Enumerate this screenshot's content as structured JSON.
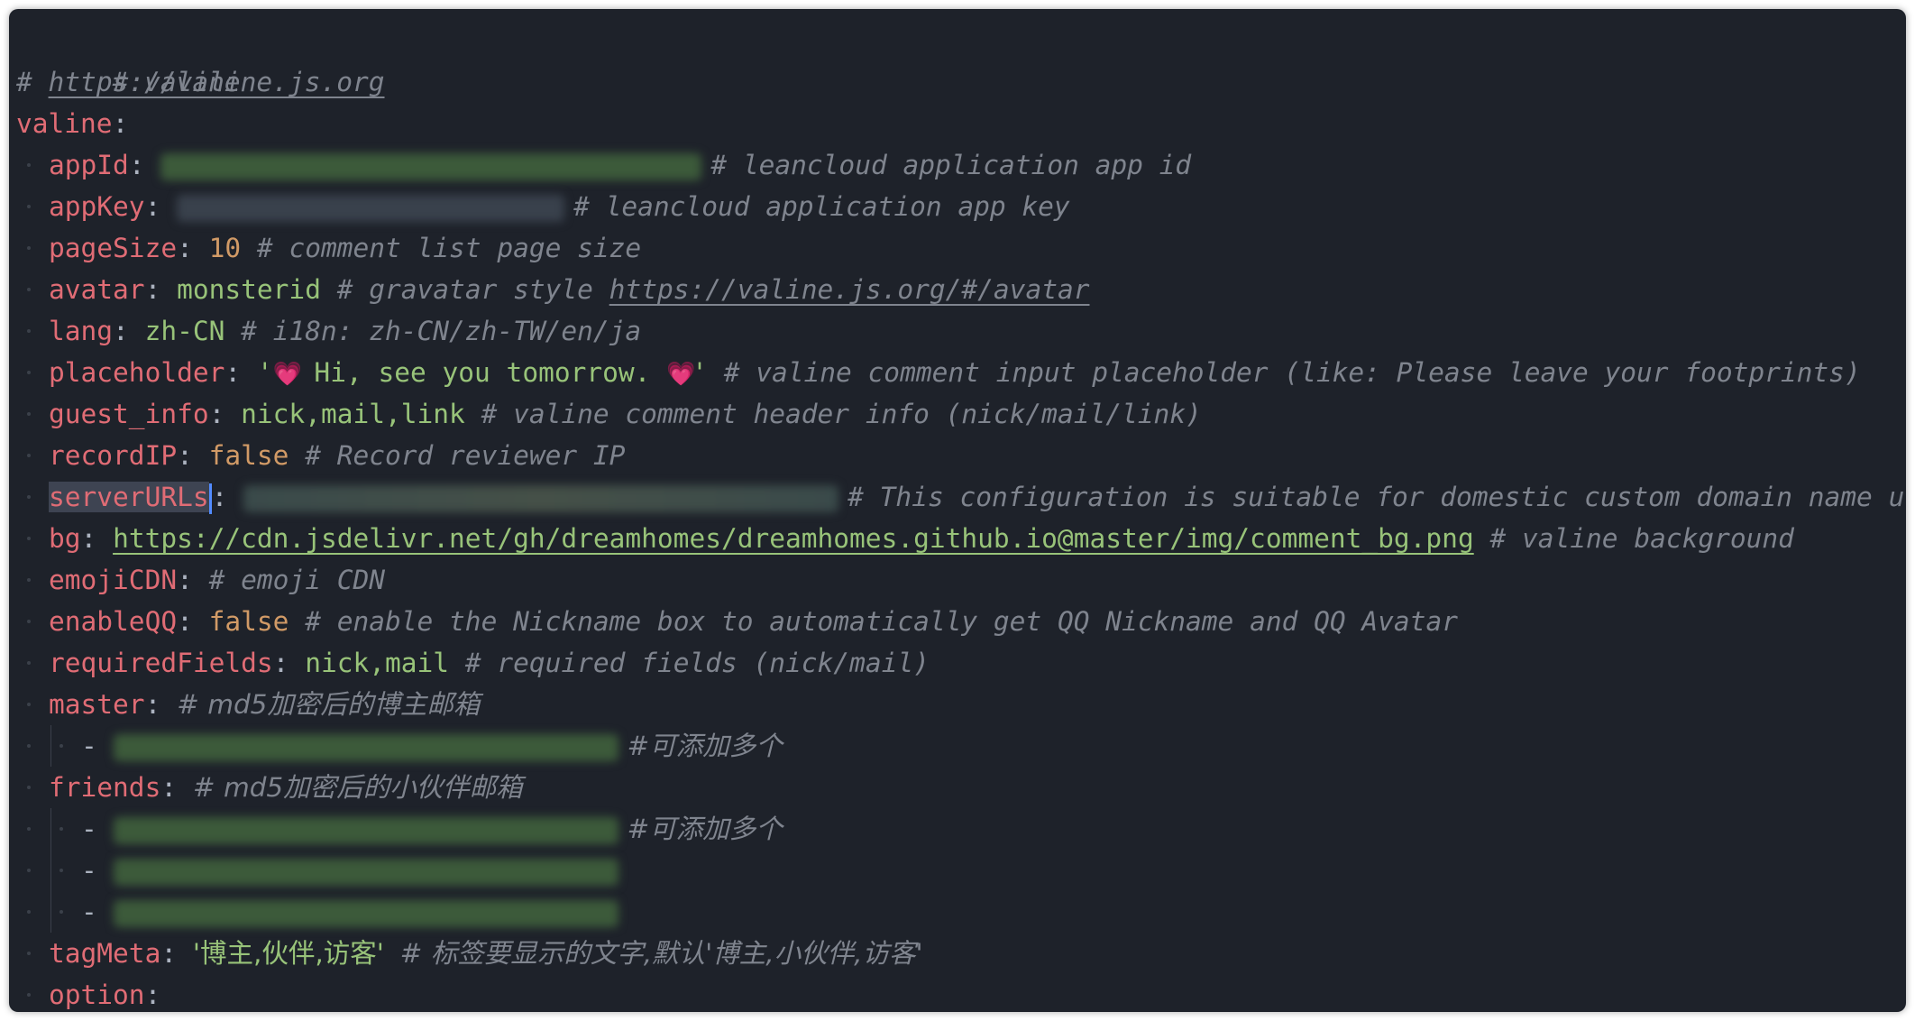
{
  "editor": {
    "lines": {
      "c1": "# valine",
      "c2_hash": "# ",
      "c2_url": "https://valine.js.org",
      "root_key": "valine",
      "appId": {
        "key": "appId",
        "comment": "# leancloud application app id"
      },
      "appKey": {
        "key": "appKey",
        "comment": "# leancloud application app key"
      },
      "pageSize": {
        "key": "pageSize",
        "value": "10",
        "comment": "# comment list page size"
      },
      "avatar": {
        "key": "avatar",
        "value": "monsterid",
        "comment": "# gravatar style ",
        "url": "https://valine.js.org/#/avatar"
      },
      "lang": {
        "key": "lang",
        "value": "zh-CN",
        "comment": "# i18n: zh-CN/zh-TW/en/ja"
      },
      "placeholder": {
        "key": "placeholder",
        "quote_open": "'",
        "text": " Hi, see you tomorrow. ",
        "quote_close": "'",
        "heart": "💗",
        "comment": "# valine comment input placeholder (like: Please leave your footprints)"
      },
      "guest_info": {
        "key": "guest_info",
        "value": "nick,mail,link",
        "comment": "# valine comment header info (nick/mail/link)"
      },
      "recordIP": {
        "key": "recordIP",
        "value": "false",
        "comment": "# Record reviewer IP"
      },
      "serverURLs": {
        "key": "serverURLs",
        "comment": "# This configuration is suitable for domestic custom domain name u"
      },
      "bg": {
        "key": "bg",
        "url": "https://cdn.jsdelivr.net/gh/dreamhomes/dreamhomes.github.io@master/img/comment_bg.png",
        "comment": "# valine background"
      },
      "emojiCDN": {
        "key": "emojiCDN",
        "comment": "# emoji CDN"
      },
      "enableQQ": {
        "key": "enableQQ",
        "value": "false",
        "comment": "# enable the Nickname box to automatically get QQ Nickname and QQ Avatar"
      },
      "requiredFields": {
        "key": "requiredFields",
        "value": "nick,mail",
        "comment": "# required fields (nick/mail)"
      },
      "master": {
        "key": "master",
        "comment": "# md5加密后的博主邮箱",
        "item_dash": "-",
        "item_comment": "#可添加多个"
      },
      "friends": {
        "key": "friends",
        "comment": "# md5加密后的小伙伴邮箱",
        "item_dash": "-",
        "item_comment": "#可添加多个"
      },
      "tagMeta": {
        "key": "tagMeta",
        "value": "'博主,伙伴,访客'",
        "comment": "# 标签要显示的文字,默认'博主,小伙伴,访客'"
      },
      "option": {
        "key": "option"
      },
      "colon": ":"
    }
  },
  "colors": {
    "background": "#1e222a",
    "key": "#e06c75",
    "string": "#98c379",
    "number": "#d19a66",
    "comment": "#7f848e",
    "selection": "#3e4452",
    "cursor": "#528bff"
  }
}
